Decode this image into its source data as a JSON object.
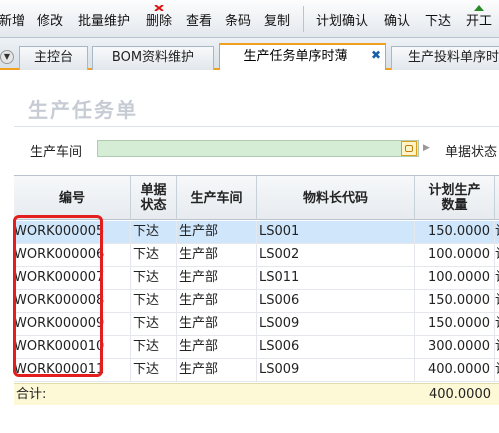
{
  "toolbar": {
    "buttons": [
      {
        "label": "新增"
      },
      {
        "label": "修改"
      },
      {
        "label": "批量维护"
      },
      {
        "label": "删除"
      },
      {
        "label": "查看"
      },
      {
        "label": "条码"
      },
      {
        "label": "复制"
      },
      {
        "label": "计划确认"
      },
      {
        "label": "确认"
      },
      {
        "label": "下达"
      },
      {
        "label": "开工"
      }
    ]
  },
  "tabs": [
    {
      "label": "主控台"
    },
    {
      "label": "BOM资料维护"
    },
    {
      "label": "生产任务单序时薄"
    },
    {
      "label": "生产投料单序时"
    }
  ],
  "page": {
    "title": "生产任务单"
  },
  "filters": {
    "workshop_label": "生产车间",
    "workshop_value": "",
    "status_label": "单据状态"
  },
  "grid": {
    "columns": [
      "编号",
      "单据\n状态",
      "生产车间",
      "物料长代码",
      "计划生产\n数量"
    ],
    "rows": [
      {
        "no": "WORK000005",
        "status": "下达",
        "workshop": "生产部",
        "material": "LS001",
        "qty": "150.0000",
        "extra": "计"
      },
      {
        "no": "WORK000006",
        "status": "下达",
        "workshop": "生产部",
        "material": "LS002",
        "qty": "100.0000",
        "extra": "计"
      },
      {
        "no": "WORK000007",
        "status": "下达",
        "workshop": "生产部",
        "material": "LS011",
        "qty": "100.0000",
        "extra": "计"
      },
      {
        "no": "WORK000008",
        "status": "下达",
        "workshop": "生产部",
        "material": "LS006",
        "qty": "150.0000",
        "extra": "计"
      },
      {
        "no": "WORK000009",
        "status": "下达",
        "workshop": "生产部",
        "material": "LS009",
        "qty": "150.0000",
        "extra": "计"
      },
      {
        "no": "WORK000010",
        "status": "下达",
        "workshop": "生产部",
        "material": "LS006",
        "qty": "300.0000",
        "extra": "计"
      },
      {
        "no": "WORK000011",
        "status": "下达",
        "workshop": "生产部",
        "material": "LS009",
        "qty": "400.0000",
        "extra": "计"
      }
    ],
    "selected_row": 0,
    "total_label": "合计:",
    "total_qty": "400.0000"
  },
  "colors": {
    "highlight": "#e21e1e",
    "tab_accent": "#f0a020",
    "selected_row": "#cfe6fb",
    "total_row": "#fdf9d6",
    "workshop_field": "#d4edd4"
  }
}
